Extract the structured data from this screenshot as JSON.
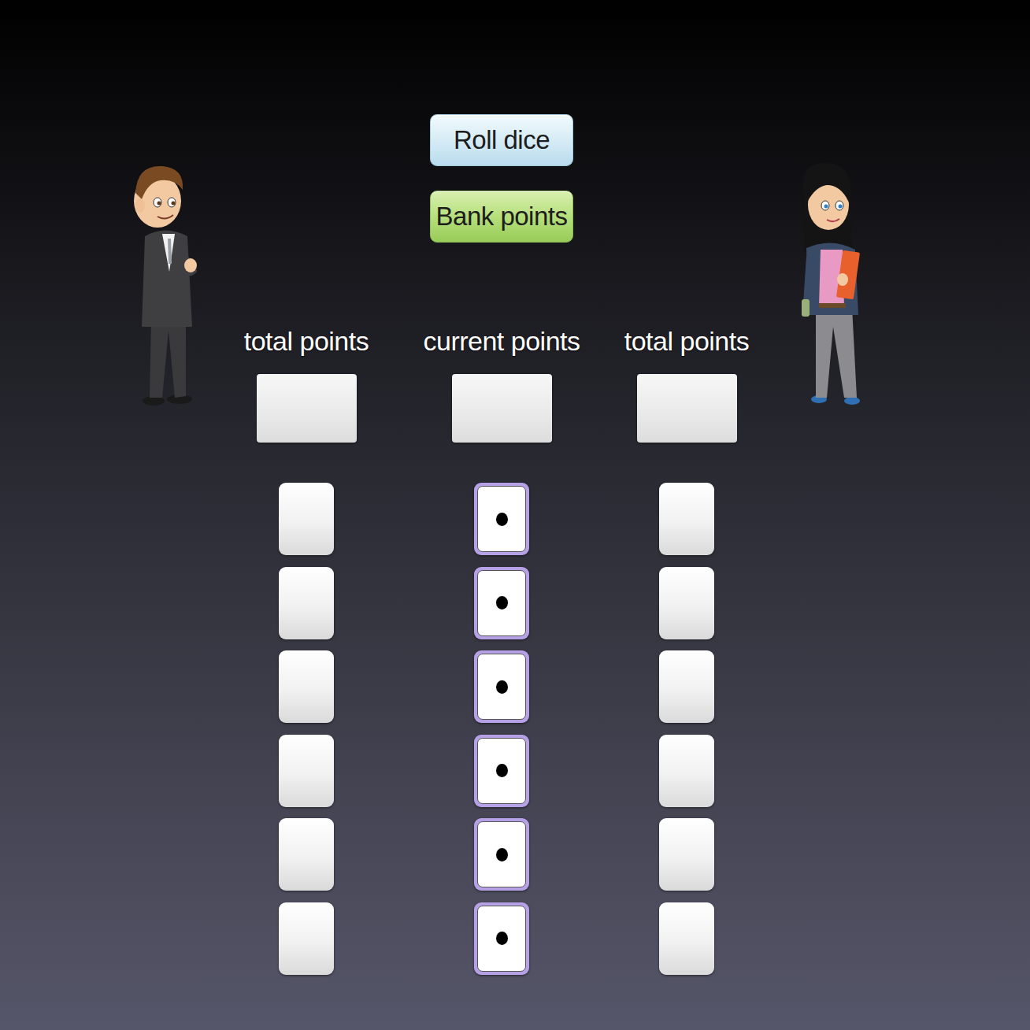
{
  "buttons": [
    {
      "label": "Roll dice",
      "kind": "roll"
    },
    {
      "label": "Bank points",
      "kind": "bank"
    }
  ],
  "columns": [
    {
      "label": "total points",
      "score": "",
      "dice": [
        {
          "pips": 0,
          "selected": false
        },
        {
          "pips": 0,
          "selected": false
        },
        {
          "pips": 0,
          "selected": false
        },
        {
          "pips": 0,
          "selected": false
        },
        {
          "pips": 0,
          "selected": false
        },
        {
          "pips": 0,
          "selected": false
        }
      ]
    },
    {
      "label": "current points",
      "score": "",
      "dice": [
        {
          "pips": 1,
          "selected": true
        },
        {
          "pips": 1,
          "selected": true
        },
        {
          "pips": 1,
          "selected": true
        },
        {
          "pips": 1,
          "selected": true
        },
        {
          "pips": 1,
          "selected": true
        },
        {
          "pips": 1,
          "selected": true
        }
      ]
    },
    {
      "label": "total points",
      "score": "",
      "dice": [
        {
          "pips": 0,
          "selected": false
        },
        {
          "pips": 0,
          "selected": false
        },
        {
          "pips": 0,
          "selected": false
        },
        {
          "pips": 0,
          "selected": false
        },
        {
          "pips": 0,
          "selected": false
        },
        {
          "pips": 0,
          "selected": false
        }
      ]
    }
  ]
}
